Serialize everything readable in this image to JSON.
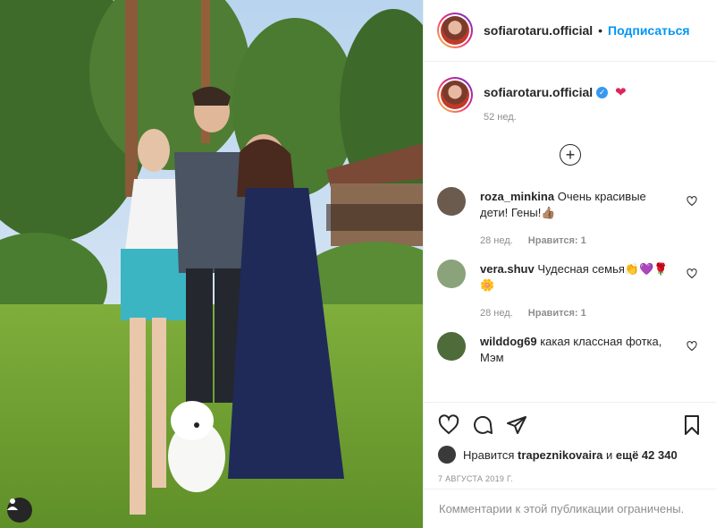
{
  "header": {
    "username": "sofiarotaru.official",
    "separator": "•",
    "follow_label": "Подписаться",
    "more_icon": "more-dots-icon"
  },
  "caption": {
    "username": "sofiarotaru.official",
    "verified": true,
    "emoji": "❤",
    "time": "52 нед."
  },
  "load_more_icon": "plus-circle-icon",
  "comments": [
    {
      "username": "roza_minkina",
      "text": "Очень красивые дети! Гены!👍🏽",
      "time": "28 нед.",
      "likes": "Нравится: 1",
      "avatar_color": "#6b5b4e"
    },
    {
      "username": "vera.shuv",
      "text": "Чудесная семья👏💜🌹🌼",
      "time": "28 нед.",
      "likes": "Нравится: 1",
      "avatar_color": "#8aa37a"
    },
    {
      "username": "wilddog69",
      "text": "какая классная фотка, Мэм",
      "time": "",
      "likes": "",
      "avatar_color": "#4e6b3a"
    }
  ],
  "actions": {
    "like_icon": "heart-icon",
    "comment_icon": "comment-icon",
    "share_icon": "paper-plane-icon",
    "save_icon": "bookmark-icon"
  },
  "likes": {
    "prefix": "Нравится",
    "user": "trapeznikovaira",
    "middle": "и",
    "count": "ещё 42 340"
  },
  "date": "7 АВГУСТА 2019 Г.",
  "comments_limited": "Комментарии к этой публикации ограничены.",
  "colors": {
    "accent": "#0095f6",
    "text": "#262626",
    "muted": "#8e8e8e",
    "border": "#efefef"
  }
}
